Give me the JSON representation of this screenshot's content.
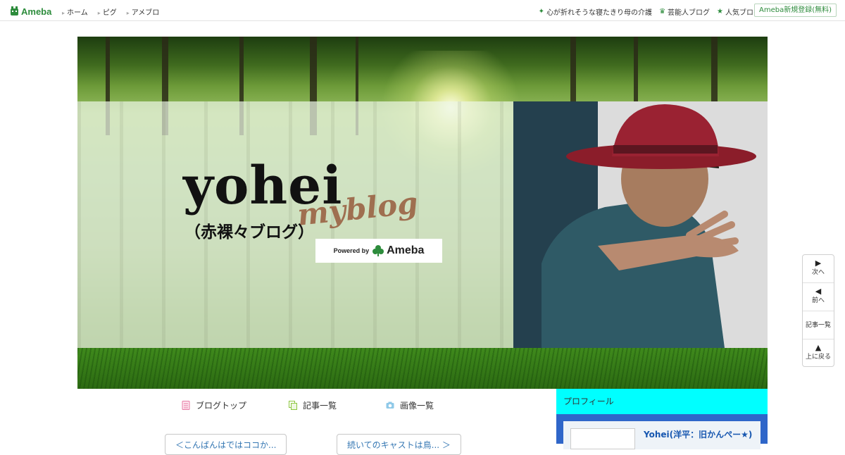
{
  "topbar": {
    "logo_text": "Ameba",
    "nav": [
      "ホーム",
      "ピグ",
      "アメブロ"
    ],
    "links": [
      {
        "icon": "sparkle-icon",
        "label": "心が折れそうな寝たきり母の介護"
      },
      {
        "icon": "crown-icon",
        "label": "芸能人ブログ"
      },
      {
        "icon": "star-icon",
        "label": "人気ブログ"
      }
    ],
    "register_label": "Ameba新規登録(無料)"
  },
  "header": {
    "title": "yohei",
    "script_title": "myblog",
    "subtitle": "（赤裸々ブログ）",
    "powered_by": "Powered by",
    "powered_brand": "Ameba"
  },
  "blog_nav": [
    {
      "icon": "document-icon",
      "label": "ブログトップ"
    },
    {
      "icon": "copy-icon",
      "label": "記事一覧"
    },
    {
      "icon": "camera-icon",
      "label": "画像一覧"
    }
  ],
  "post_nav": {
    "prev_label": "＜こんばんはではココか...",
    "next_label": "続いてのキャストは鳥... ＞"
  },
  "profile": {
    "header": "プロフィール",
    "name": "Yohei(洋平：旧かんぺー★)"
  },
  "side_nav": {
    "next": "次へ",
    "prev": "前へ",
    "list": "記事一覧",
    "top": "上に戻る"
  },
  "colors": {
    "ameba_green": "#2d8c3c",
    "profile_header_bg": "#00ffff",
    "profile_body_bg": "#2f66c9",
    "link_blue": "#3577b3"
  }
}
